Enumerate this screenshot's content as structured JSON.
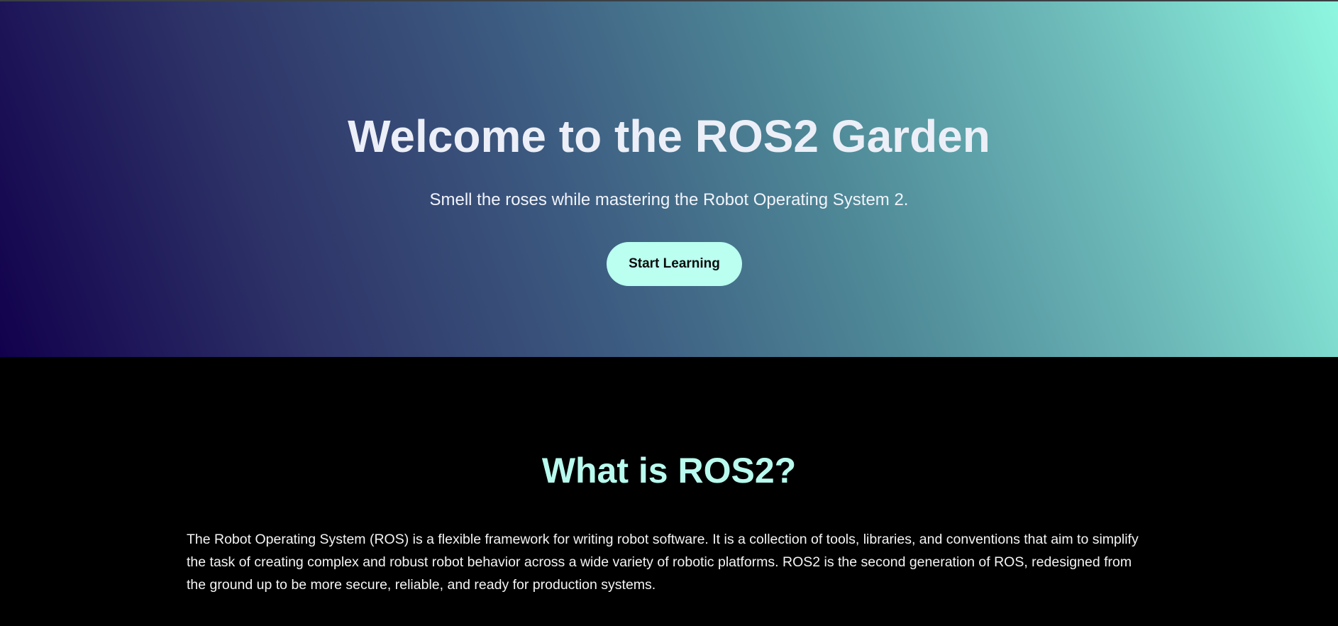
{
  "hero": {
    "title": "Welcome to the ROS2 Garden",
    "subtitle": "Smell the roses while mastering the Robot Operating System 2.",
    "cta_label": "Start Learning"
  },
  "about": {
    "title": "What is ROS2?",
    "body": "The Robot Operating System (ROS) is a flexible framework for writing robot software. It is a collection of tools, libraries, and conventions that aim to simplify the task of creating complex and robust robot behavior across a wide variety of robotic platforms. ROS2 is the second generation of ROS, redesigned from the ground up to be more secure, reliable, and ready for production systems."
  },
  "colors": {
    "gradient_start": "#12004d",
    "gradient_end": "#8ef7e0",
    "accent": "#b8fbee",
    "button_bg": "#bafff0",
    "background": "#000000"
  }
}
